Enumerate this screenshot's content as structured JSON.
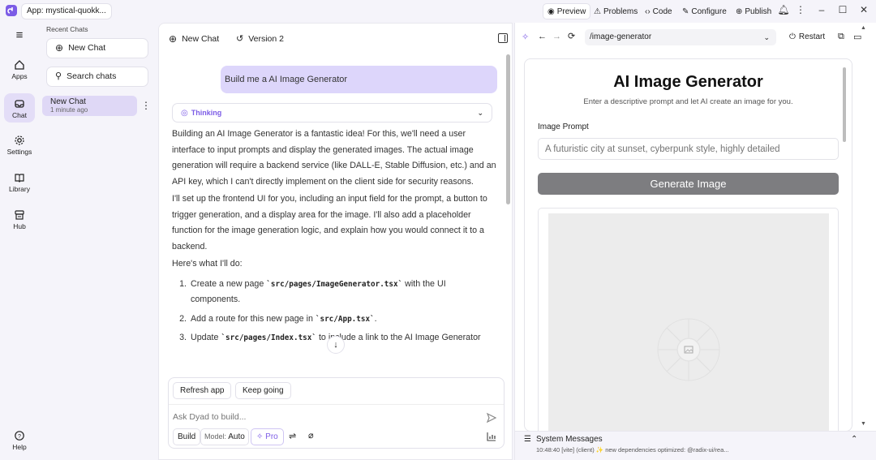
{
  "app": {
    "title": "App: mystical-quokk..."
  },
  "topbar": {
    "preview": "Preview",
    "problems": "Problems",
    "code": "Code",
    "configure": "Configure",
    "publish": "Publish"
  },
  "rail": {
    "apps": "Apps",
    "chat": "Chat",
    "settings": "Settings",
    "library": "Library",
    "hub": "Hub",
    "help": "Help"
  },
  "sidebar": {
    "recent_label": "Recent Chats",
    "new_chat": "New Chat",
    "search": "Search chats",
    "chat_title": "New Chat",
    "chat_time": "1 minute ago"
  },
  "chat": {
    "header_new": "New Chat",
    "header_version": "Version 2",
    "user_message": "Build me a AI Image Generator",
    "thinking": "Thinking",
    "para1": "Building an AI Image Generator is a fantastic idea! For this, we'll need a user interface to input prompts and display the generated images. The actual image generation will require a backend service (like DALL-E, Stable Diffusion, etc.) and an API key, which I can't directly implement on the client side for security reasons.",
    "para2": "I'll set up the frontend UI for you, including an input field for the prompt, a button to trigger generation, and a display area for the image. I'll also add a placeholder function for the image generation logic, and explain how you would connect it to a backend.",
    "para3": "Here's what I'll do:",
    "steps": [
      {
        "pre": "Create a new page ",
        "code": "`src/pages/ImageGenerator.tsx`",
        "post": " with the UI components."
      },
      {
        "pre": "Add a route for this new page in ",
        "code": "`src/App.tsx`",
        "post": "."
      },
      {
        "pre": "Update ",
        "code": "`src/pages/Index.tsx`",
        "post": " to include a link to the AI Image Generator"
      }
    ],
    "refresh": "Refresh app",
    "keep_going": "Keep going",
    "input_placeholder": "Ask Dyad to build...",
    "build": "Build",
    "model_label": "Model:",
    "model_value": "Auto",
    "pro": "Pro"
  },
  "preview": {
    "url": "/image-generator",
    "restart": "Restart",
    "title": "AI Image Generator",
    "subtitle": "Enter a descriptive prompt and let AI create an image for you.",
    "prompt_label": "Image Prompt",
    "prompt_placeholder": "A futuristic city at sunset, cyberpunk style, highly detailed",
    "generate": "Generate Image",
    "sys_title": "System Messages",
    "sys_msg": "10:48:40 [vite] (client) ✨ new dependencies optimized: @radix-ui/rea..."
  },
  "colors": {
    "accent": "#7c5ce6",
    "user_bubble": "#ddd6fb",
    "generate_btn": "#7d7d80"
  }
}
